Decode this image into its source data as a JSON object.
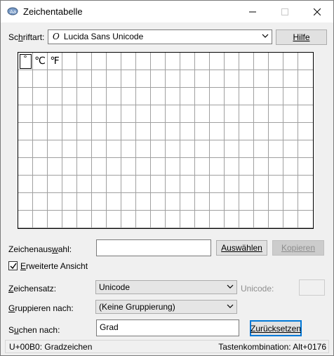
{
  "window": {
    "title": "Zeichentabelle"
  },
  "font": {
    "label": "Schriftart:",
    "selected": "Lucida Sans Unicode",
    "font_icon": "O",
    "help_button": "Hilfe"
  },
  "grid": {
    "columns": 20,
    "rows": 10,
    "chars": [
      "°",
      "℃",
      "℉"
    ]
  },
  "selection": {
    "label": "Zeichenauswahl:",
    "value": "",
    "select_button": "Auswählen",
    "copy_button": "Kopieren"
  },
  "advanced": {
    "checked": true,
    "label": "Erweiterte Ansicht"
  },
  "charset": {
    "label": "Zeichensatz:",
    "selected": "Unicode",
    "unicode_label": "Unicode:",
    "unicode_value": ""
  },
  "group": {
    "label": "Gruppieren nach:",
    "selected": "(Keine Gruppierung)"
  },
  "search": {
    "label": "Suchen nach:",
    "value": "Grad",
    "reset_button": "Zurücksetzen"
  },
  "status": {
    "left": "U+00B0: Gradzeichen",
    "right": "Tastenkombination: Alt+0176"
  },
  "icons": {
    "minimize": "minimize-icon",
    "maximize": "maximize-icon",
    "close": "close-icon",
    "dropdown": "chevron-down-icon",
    "check": "checkmark-icon"
  }
}
